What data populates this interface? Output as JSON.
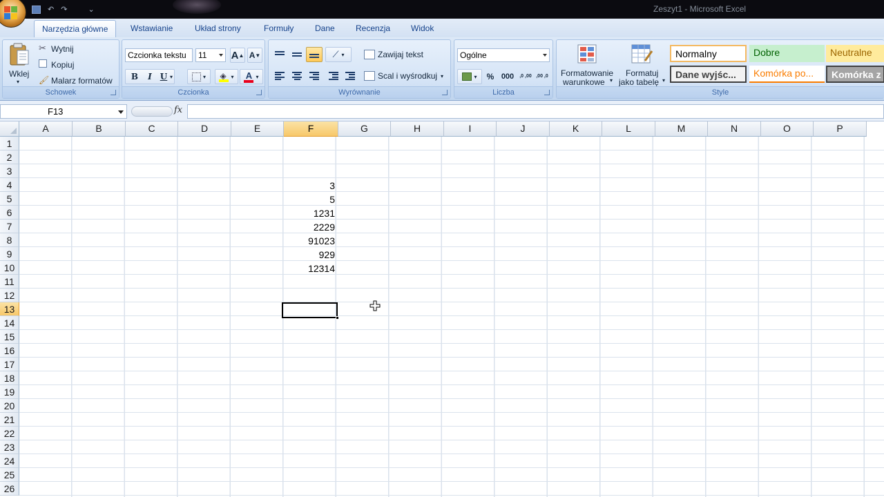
{
  "window": {
    "title": "Zeszyt1 - Microsoft Excel"
  },
  "qat": {
    "undo": "↶",
    "redo": "↷",
    "customize": "⌄"
  },
  "tabs": [
    {
      "label": "Narzędzia główne",
      "active": true
    },
    {
      "label": "Wstawianie"
    },
    {
      "label": "Układ strony"
    },
    {
      "label": "Formuły"
    },
    {
      "label": "Dane"
    },
    {
      "label": "Recenzja"
    },
    {
      "label": "Widok"
    }
  ],
  "ribbon": {
    "clipboard": {
      "label": "Schowek",
      "paste": "Wklej",
      "cut": "Wytnij",
      "copy": "Kopiuj",
      "format_painter": "Malarz formatów"
    },
    "font": {
      "label": "Czcionka",
      "font_name": "Czcionka tekstu",
      "font_size": "11",
      "grow": "A",
      "shrink": "A",
      "bold": "B",
      "italic": "I",
      "underline": "U",
      "font_color_letter": "A"
    },
    "alignment": {
      "label": "Wyrównanie",
      "wrap_text": "Zawijaj tekst",
      "merge_center": "Scal i wyśrodkuj"
    },
    "number": {
      "label": "Liczba",
      "format": "Ogólne",
      "percent": "%",
      "thousands": "000",
      "inc_decimal": ",0 ,00",
      "dec_decimal": ",00 ,0"
    },
    "styles": {
      "label": "Style",
      "conditional_formatting_1": "Formatowanie",
      "conditional_formatting_2": "warunkowe",
      "format_as_table_1": "Formatuj",
      "format_as_table_2": "jako tabelę",
      "cells": [
        {
          "name": "Normalny"
        },
        {
          "name": "Dobre"
        },
        {
          "name": "Neutralne"
        },
        {
          "name": "Dane wyjśc..."
        },
        {
          "name": "Komórka po..."
        },
        {
          "name": "Komórka z"
        }
      ],
      "colors": {
        "good_bg": "#c6efce",
        "good_fg": "#006100",
        "neutral_bg": "#ffeb9c",
        "neutral_fg": "#9c6500",
        "linked_fg": "#fa7d00",
        "check_bg": "#a5a5a5"
      }
    }
  },
  "formula_bar": {
    "name_box": "F13",
    "fx": "fx",
    "content": ""
  },
  "grid": {
    "columns": [
      "A",
      "B",
      "C",
      "D",
      "E",
      "F",
      "G",
      "H",
      "I",
      "J",
      "K",
      "L",
      "M",
      "N",
      "O",
      "P"
    ],
    "selected_column": "F",
    "rows": [
      "1",
      "2",
      "3",
      "4",
      "5",
      "6",
      "7",
      "8",
      "9",
      "10",
      "11",
      "12",
      "13",
      "14",
      "15",
      "16",
      "17",
      "18",
      "19",
      "20",
      "21",
      "22",
      "23",
      "24",
      "25",
      "26"
    ],
    "selected_row": "13",
    "active_cell": "F13",
    "values": [
      {
        "cell": "F4",
        "value": "3"
      },
      {
        "cell": "F5",
        "value": "5"
      },
      {
        "cell": "F6",
        "value": "1231"
      },
      {
        "cell": "F7",
        "value": "2229"
      },
      {
        "cell": "F8",
        "value": "91023"
      },
      {
        "cell": "F9",
        "value": "929"
      },
      {
        "cell": "F10",
        "value": "12314"
      }
    ]
  }
}
